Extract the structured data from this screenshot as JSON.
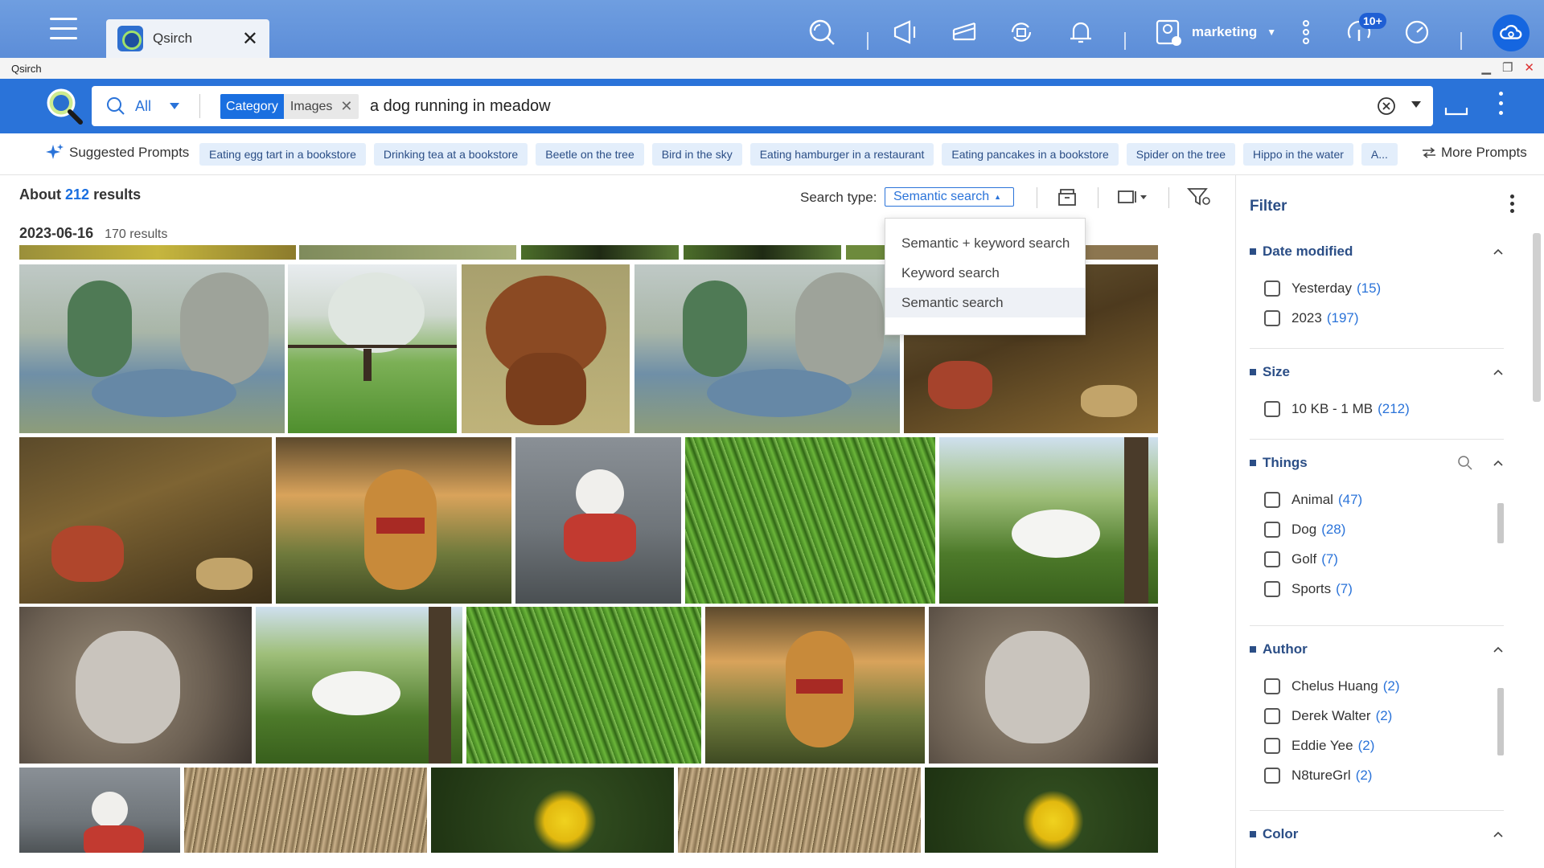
{
  "app": {
    "tab_title": "Qsirch",
    "window_title": "Qsirch",
    "user_name": "marketing",
    "notification_badge": "10+"
  },
  "search": {
    "scope": "All",
    "category_key": "Category",
    "category_value": "Images",
    "query": "a dog running in meadow"
  },
  "prompts": {
    "label": "Suggested Prompts",
    "items": [
      "Eating egg tart in a bookstore",
      "Drinking tea at a bookstore",
      "Beetle on the tree",
      "Bird in the sky",
      "Eating hamburger in a restaurant",
      "Eating pancakes in a bookstore",
      "Spider on the tree",
      "Hippo in the water",
      "A..."
    ],
    "more_label": "More Prompts"
  },
  "results": {
    "prefix": "About",
    "count": "212",
    "suffix": "results",
    "search_type_label": "Search type:",
    "search_type_value": "Semantic search",
    "date_group": "2023-06-16",
    "date_group_count": "170 results"
  },
  "dropdown": {
    "options": [
      "Semantic + keyword search",
      "Keyword search",
      "Semantic search"
    ],
    "selected": "Semantic search"
  },
  "filter": {
    "title": "Filter",
    "sections": {
      "date_modified": {
        "label": "Date modified",
        "options": [
          {
            "label": "Yesterday",
            "count": "(15)"
          },
          {
            "label": "2023",
            "count": "(197)"
          }
        ]
      },
      "size": {
        "label": "Size",
        "options": [
          {
            "label": "10 KB - 1 MB",
            "count": "(212)"
          }
        ]
      },
      "things": {
        "label": "Things",
        "options": [
          {
            "label": "Animal",
            "count": "(47)"
          },
          {
            "label": "Dog",
            "count": "(28)"
          },
          {
            "label": "Golf",
            "count": "(7)"
          },
          {
            "label": "Sports",
            "count": "(7)"
          }
        ]
      },
      "author": {
        "label": "Author",
        "options": [
          {
            "label": "Chelus Huang",
            "count": "(2)"
          },
          {
            "label": "Derek Walter",
            "count": "(2)"
          },
          {
            "label": "Eddie Yee",
            "count": "(2)"
          },
          {
            "label": "N8tureGrl",
            "count": "(2)"
          }
        ]
      },
      "color": {
        "label": "Color"
      }
    }
  },
  "colors": {
    "accent": "#2a73d9",
    "topbar": "#6f9ee0",
    "chip_bg": "#e3eefb",
    "filter_heading": "#2b4e86"
  }
}
